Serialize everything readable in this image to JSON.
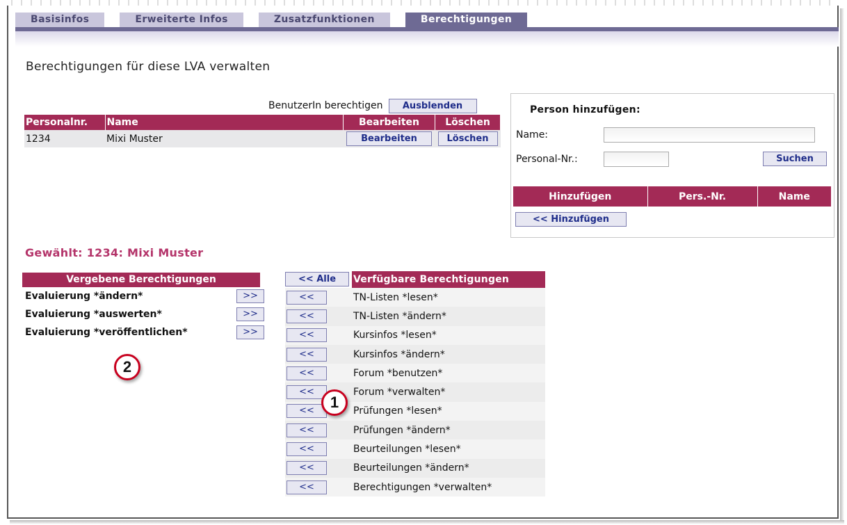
{
  "tabs": [
    {
      "label": "Basisinfos"
    },
    {
      "label": "Erweiterte Infos"
    },
    {
      "label": "Zusatzfunktionen"
    },
    {
      "label": "Berechtigungen"
    }
  ],
  "page_title": "Berechtigungen für diese LVA verwalten",
  "authorize": {
    "label": "BenutzerIn berechtigen",
    "hide_button": "Ausblenden"
  },
  "users_table": {
    "headers": {
      "persnr": "Personalnr.",
      "name": "Name",
      "edit": "Bearbeiten",
      "delete": "Löschen"
    },
    "rows": [
      {
        "persnr": "1234",
        "name": "Mixi Muster",
        "edit": "Bearbeiten",
        "delete": "Löschen"
      }
    ]
  },
  "add_person": {
    "title": "Person hinzufügen:",
    "name_label": "Name:",
    "name_value": "",
    "persnr_label": "Personal-Nr.:",
    "persnr_value": "",
    "search_button": "Suchen",
    "result_headers": {
      "add": "Hinzufügen",
      "persnr": "Pers.-Nr.",
      "name": "Name"
    },
    "add_button": "<< Hinzufügen"
  },
  "selected": "Gewählt: 1234: Mixi Muster",
  "assigned": {
    "title": "Vergebene Berechtigungen",
    "move_label": ">>",
    "items": [
      {
        "label": "Evaluierung *ändern*"
      },
      {
        "label": "Evaluierung *auswerten*"
      },
      {
        "label": "Evaluierung *veröffentlichen*"
      }
    ]
  },
  "available": {
    "all_button": "<< Alle",
    "title": "Verfügbare Berechtigungen",
    "move_label": "<<",
    "items": [
      {
        "label": "TN-Listen *lesen*"
      },
      {
        "label": "TN-Listen *ändern*"
      },
      {
        "label": "Kursinfos *lesen*"
      },
      {
        "label": "Kursinfos *ändern*"
      },
      {
        "label": "Forum *benutzen*"
      },
      {
        "label": "Forum *verwalten*"
      },
      {
        "label": "Prüfungen *lesen*"
      },
      {
        "label": "Prüfungen *ändern*"
      },
      {
        "label": "Beurteilungen *lesen*"
      },
      {
        "label": "Beurteilungen *ändern*"
      },
      {
        "label": "Berechtigungen *verwalten*"
      }
    ]
  },
  "markers": [
    {
      "label": "1"
    },
    {
      "label": "2"
    }
  ],
  "colors": {
    "header": "#a32a56",
    "tab_active": "#6e6a94",
    "tab_inactive": "#c9c6dc",
    "selected_text": "#b4346a",
    "marker_ring": "#c8001e"
  }
}
